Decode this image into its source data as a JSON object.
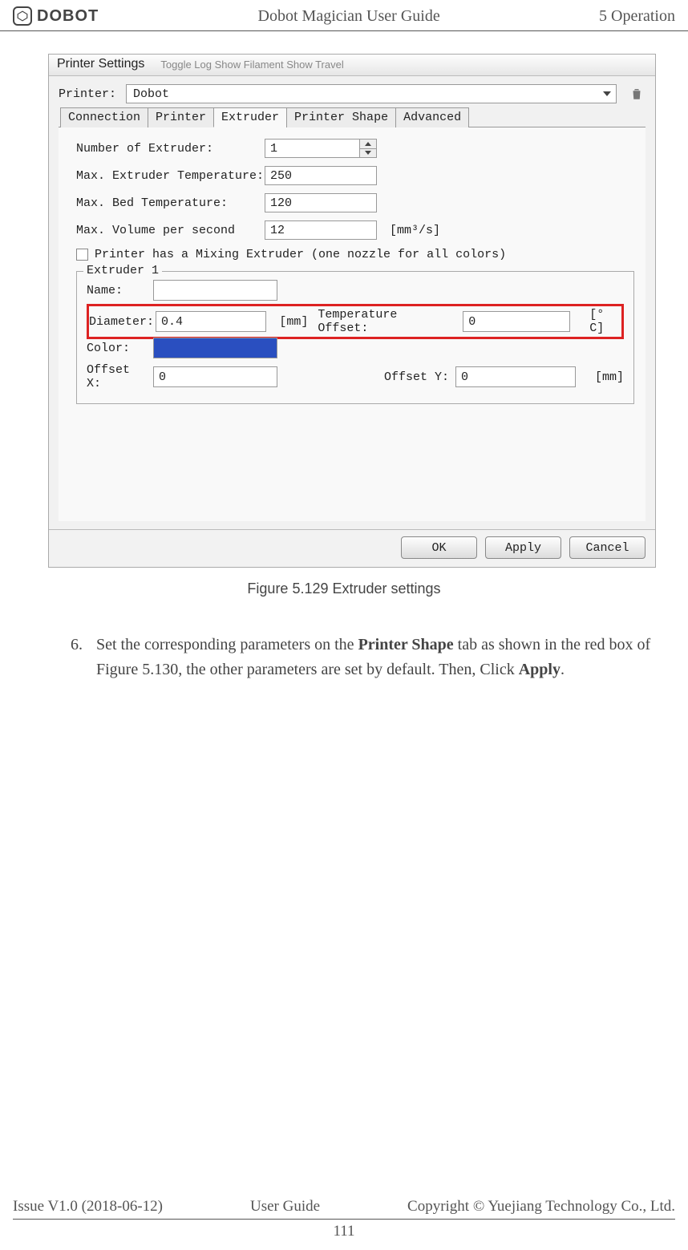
{
  "header": {
    "logo_text": "DOBOT",
    "title": "Dobot Magician User Guide",
    "section": "5 Operation"
  },
  "dialog": {
    "title": "Printer Settings",
    "greyed_menu": "Toggle Log    Show Filament    Show Travel",
    "printer_label": "Printer:",
    "printer_value": "Dobot",
    "tabs": [
      "Connection",
      "Printer",
      "Extruder",
      "Printer Shape",
      "Advanced"
    ],
    "active_tab_index": 2,
    "fields": {
      "num_extruder": {
        "label": "Number of Extruder:",
        "value": "1"
      },
      "max_temp": {
        "label": "Max. Extruder Temperature:",
        "value": "250"
      },
      "max_bed": {
        "label": "Max. Bed Temperature:",
        "value": "120"
      },
      "max_vol": {
        "label": "Max. Volume per second",
        "value": "12",
        "unit": "[mm³/s]"
      },
      "mixing_label": "Printer has a Mixing Extruder (one nozzle for all colors)"
    },
    "extruder1": {
      "title": "Extruder 1",
      "name_lbl": "Name:",
      "name_val": "",
      "dia_lbl": "Diameter:",
      "dia_val": "0.4",
      "dia_unit": "[mm]",
      "temp_off_lbl": "Temperature Offset:",
      "temp_off_val": "0",
      "temp_off_unit": "[° C]",
      "color_lbl": "Color:",
      "offx_lbl": "Offset X:",
      "offx_val": "0",
      "offy_lbl": "Offset Y:",
      "offy_val": "0",
      "offy_unit": "[mm]"
    },
    "buttons": {
      "ok": "OK",
      "apply": "Apply",
      "cancel": "Cancel"
    }
  },
  "caption": "Figure 5.129    Extruder settings",
  "body": {
    "step_num": "6.",
    "text_a": "Set the corresponding parameters on the ",
    "bold_a": "Printer Shape",
    "text_b": " tab as shown in the red box of Figure 5.130, the other parameters are set by default. Then, Click ",
    "bold_b": "Apply",
    "text_c": "."
  },
  "footer": {
    "left": "Issue V1.0 (2018-06-12)",
    "mid": "User Guide",
    "right": "Copyright © Yuejiang Technology Co., Ltd.",
    "page": "111"
  }
}
